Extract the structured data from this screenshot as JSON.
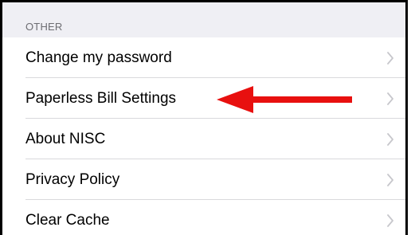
{
  "section": {
    "title": "OTHER"
  },
  "rows": [
    {
      "label": "Change my password",
      "icon": "chevron-right-icon"
    },
    {
      "label": "Paperless Bill Settings",
      "icon": "chevron-right-icon"
    },
    {
      "label": "About NISC",
      "icon": "chevron-right-icon"
    },
    {
      "label": "Privacy Policy",
      "icon": "chevron-right-icon"
    },
    {
      "label": "Clear Cache",
      "icon": "chevron-right-icon"
    }
  ],
  "annotation": {
    "icon": "red-arrow-icon",
    "color": "#e8100f",
    "points_to": "Paperless Bill Settings"
  },
  "colors": {
    "section_bg": "#efeff4",
    "section_text": "#6d6d72",
    "separator": "#d9d9dc",
    "chevron": "#c7c7cc"
  }
}
